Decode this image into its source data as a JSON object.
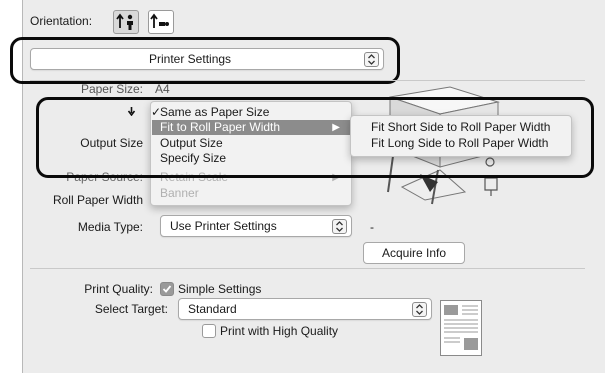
{
  "orientation": {
    "label": "Orientation:"
  },
  "printer_settings": {
    "value": "Printer Settings"
  },
  "paper_size": {
    "label": "Paper Size:",
    "value": "A4"
  },
  "output_size": {
    "label": "Output Size"
  },
  "paper_source": {
    "label": "Paper Source:"
  },
  "roll_paper_width": {
    "label": "Roll Paper Width"
  },
  "menu": {
    "items": [
      {
        "label": "Same as Paper Size",
        "checked": true
      },
      {
        "label": "Fit to Roll Paper Width",
        "highlighted": true,
        "has_submenu": true
      },
      {
        "label": "Output Size"
      },
      {
        "label": "Specify Size"
      },
      {
        "label": "Retain Scale",
        "disabled": true,
        "has_submenu": true
      },
      {
        "label": "Banner",
        "disabled": true
      }
    ],
    "submenu": [
      {
        "label": "Fit Short Side to Roll Paper Width"
      },
      {
        "label": "Fit Long Side to Roll Paper Width"
      }
    ]
  },
  "media_type": {
    "label": "Media Type:",
    "value": "Use Printer Settings",
    "dash": "-"
  },
  "acquire_info": {
    "label": "Acquire Info"
  },
  "print_quality": {
    "label": "Print Quality:",
    "checkbox_label": "Simple Settings",
    "checked": true
  },
  "select_target": {
    "label": "Select Target:",
    "value": "Standard"
  },
  "high_quality": {
    "label": "Print with High Quality",
    "checked": false
  },
  "colors": {
    "callout": "#0a0a0a",
    "highlight": "#8c8c8c",
    "panel": "#ececec"
  }
}
